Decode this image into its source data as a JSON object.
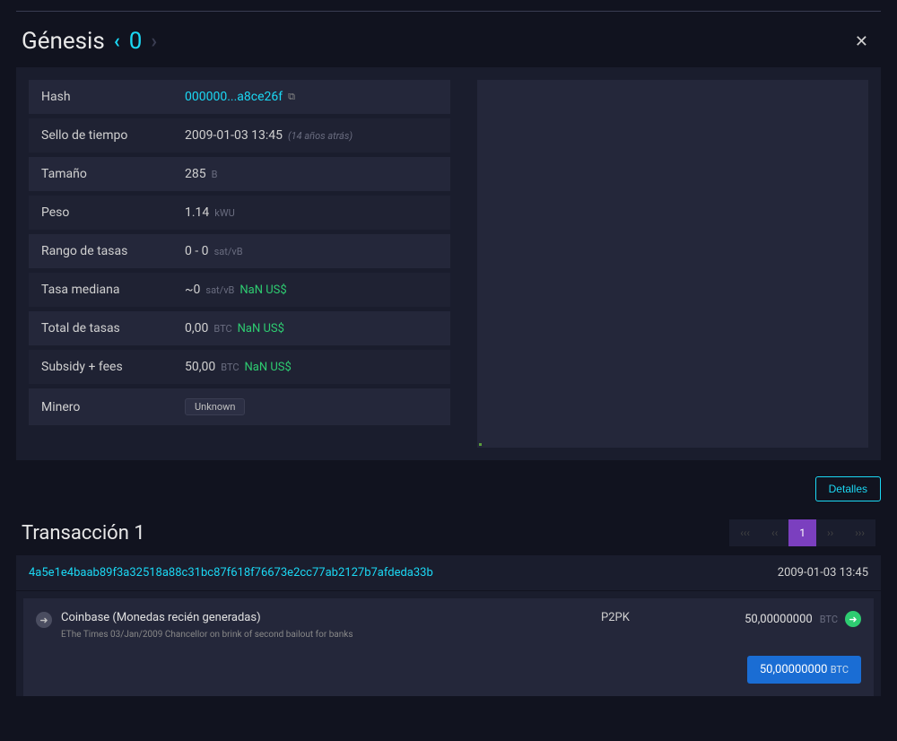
{
  "header": {
    "title": "Génesis",
    "block_number": "0",
    "close_label": "✕"
  },
  "details": {
    "hash_label": "Hash",
    "hash_value": "000000...a8ce26f",
    "timestamp_label": "Sello de tiempo",
    "timestamp_value": "2009-01-03 13:45",
    "timestamp_relative": "(14 años atrás)",
    "size_label": "Tamaño",
    "size_value": "285",
    "size_unit": "B",
    "weight_label": "Peso",
    "weight_value": "1.14",
    "weight_unit": "kWU",
    "feerange_label": "Rango de tasas",
    "feerange_value": "0 - 0",
    "feerange_unit": "sat/vB",
    "medianfee_label": "Tasa mediana",
    "medianfee_value": "~0",
    "medianfee_unit": "sat/vB",
    "medianfee_usd": "NaN US$",
    "totalfees_label": "Total de tasas",
    "totalfees_value": "0,00",
    "totalfees_unit": "BTC",
    "totalfees_usd": "NaN US$",
    "subsidy_label": "Subsidy + fees",
    "subsidy_value": "50,00",
    "subsidy_unit": "BTC",
    "subsidy_usd": "NaN US$",
    "miner_label": "Minero",
    "miner_value": "Unknown"
  },
  "actions": {
    "details_button": "Detalles"
  },
  "tx_section": {
    "title": "Transacción 1"
  },
  "pagination": {
    "first": "‹‹‹",
    "prev": "‹‹",
    "current": "1",
    "next": "››",
    "last": "›››"
  },
  "tx": {
    "hash": "4a5e1e4baab89f3a32518a88c31bc87f618f76673e2cc77ab2127b7afdeda33b",
    "time": "2009-01-03 13:45",
    "input_label": "Coinbase (Monedas recién generadas)",
    "input_sub": "EThe Times 03/Jan/2009 Chancellor on brink of second bailout for banks",
    "output_type": "P2PK",
    "output_amount": "50,00000000",
    "output_unit": "BTC",
    "total_amount": "50,00000000",
    "total_unit": "BTC"
  }
}
